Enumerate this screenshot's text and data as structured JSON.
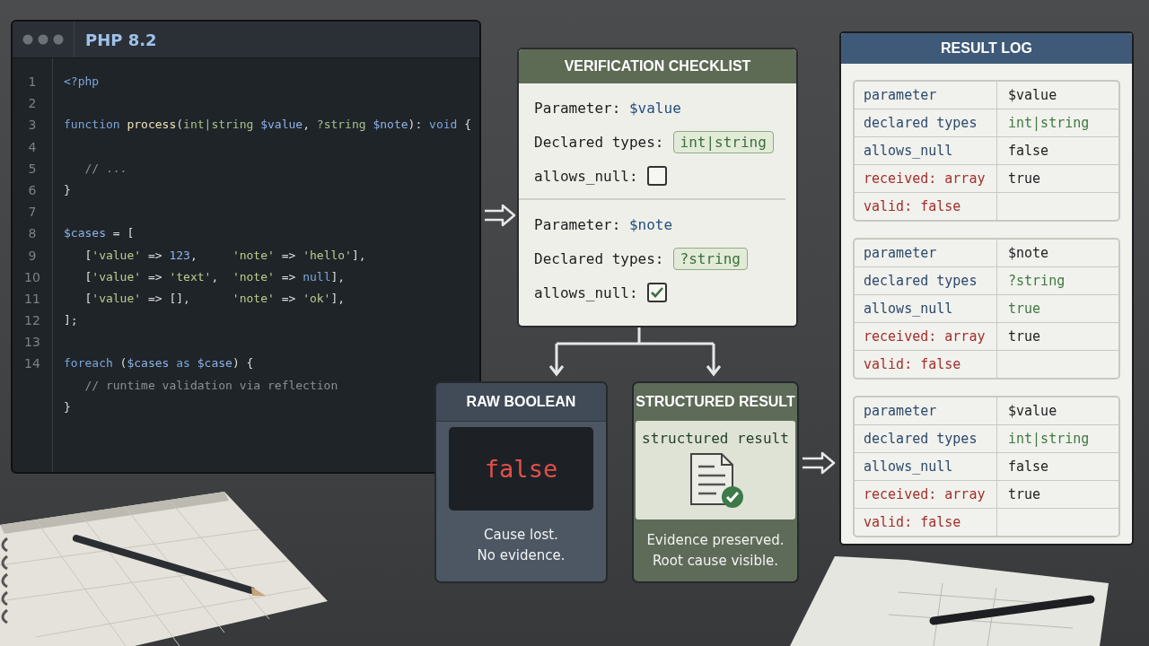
{
  "editor": {
    "title": "PHP 8.2",
    "lines": [
      {
        "number": "1",
        "tokens": [
          {
            "kind": "keyword",
            "text": "<?php"
          }
        ]
      },
      {
        "number": "2"
      },
      {
        "number": "3",
        "tokens": [
          {
            "kind": "keyword",
            "text": "function"
          },
          {
            "kind": "function",
            "text": " process"
          },
          {
            "kind": "plain",
            "text": "("
          },
          {
            "kind": "type",
            "text": "int|string"
          },
          {
            "kind": "variable",
            "text": " $value"
          },
          {
            "kind": "plain",
            "text": ", "
          },
          {
            "kind": "type",
            "text": "?string"
          },
          {
            "kind": "variable",
            "text": " $note"
          },
          {
            "kind": "plain",
            "text": "): "
          },
          {
            "kind": "keyword",
            "text": "void"
          },
          {
            "kind": "plain",
            "text": " {"
          }
        ]
      },
      {
        "number": "4"
      },
      {
        "number": "5",
        "tokens": [
          {
            "kind": "comment",
            "text": "   // ..."
          }
        ]
      },
      {
        "number": "6",
        "tokens": [
          {
            "kind": "plain",
            "text": "}"
          }
        ]
      },
      {
        "number": "7"
      },
      {
        "number": "8",
        "tokens": [
          {
            "kind": "variable",
            "text": "$cases"
          },
          {
            "kind": "plain",
            "text": " = ["
          }
        ]
      },
      {
        "number": "9",
        "tokens": [
          {
            "kind": "plain",
            "text": "   ["
          },
          {
            "kind": "string",
            "text": "'value'"
          },
          {
            "kind": "plain",
            "text": " => "
          },
          {
            "kind": "number",
            "text": "123"
          },
          {
            "kind": "plain",
            "text": ",     "
          },
          {
            "kind": "string",
            "text": "'note'"
          },
          {
            "kind": "plain",
            "text": " => "
          },
          {
            "kind": "string",
            "text": "'hello'"
          },
          {
            "kind": "plain",
            "text": "],"
          }
        ]
      },
      {
        "number": "10",
        "tokens": [
          {
            "kind": "plain",
            "text": "   ["
          },
          {
            "kind": "string",
            "text": "'value'"
          },
          {
            "kind": "plain",
            "text": " => "
          },
          {
            "kind": "string",
            "text": "'text'"
          },
          {
            "kind": "plain",
            "text": ",  "
          },
          {
            "kind": "string",
            "text": "'note'"
          },
          {
            "kind": "plain",
            "text": " => "
          },
          {
            "kind": "keyword",
            "text": "null"
          },
          {
            "kind": "plain",
            "text": "],"
          }
        ]
      },
      {
        "number": "11",
        "tokens": [
          {
            "kind": "plain",
            "text": "   ["
          },
          {
            "kind": "string",
            "text": "'value'"
          },
          {
            "kind": "plain",
            "text": " => [],      "
          },
          {
            "kind": "string",
            "text": "'note'"
          },
          {
            "kind": "plain",
            "text": " => "
          },
          {
            "kind": "string",
            "text": "'ok'"
          },
          {
            "kind": "plain",
            "text": "],"
          }
        ]
      },
      {
        "number": "12",
        "tokens": [
          {
            "kind": "plain",
            "text": "];"
          }
        ]
      },
      {
        "number": "13"
      },
      {
        "number": "14",
        "tokens": [
          {
            "kind": "keyword",
            "text": "foreach"
          },
          {
            "kind": "plain",
            "text": " ("
          },
          {
            "kind": "variable",
            "text": "$cases"
          },
          {
            "kind": "keyword",
            "text": " as "
          },
          {
            "kind": "variable",
            "text": "$case"
          },
          {
            "kind": "plain",
            "text": ") {"
          }
        ]
      },
      {
        "tokens": [
          {
            "kind": "comment",
            "text": "   // runtime validation via reflection"
          }
        ]
      },
      {
        "tokens": [
          {
            "kind": "plain",
            "text": "}"
          }
        ]
      }
    ]
  },
  "checklist": {
    "title": "VERIFICATION CHECKLIST",
    "params": [
      {
        "label": "Parameter:",
        "name": "$value",
        "types_label": "Declared types:",
        "types": "int|string",
        "null_label": "allows_null:",
        "checked": false
      },
      {
        "label": "Parameter:",
        "name": "$note",
        "types_label": "Declared types:",
        "types": "?string",
        "null_label": "allows_null:",
        "checked": true
      }
    ]
  },
  "raw_card": {
    "title": "RAW BOOLEAN",
    "value": "false",
    "caption": [
      "Cause lost.",
      "No evidence."
    ]
  },
  "structured_card": {
    "title": "STRUCTURED RESULT",
    "label": "structured result",
    "caption": [
      "Evidence preserved.",
      "Root cause visible."
    ]
  },
  "result_log": {
    "title": "RESULT LOG",
    "groups": [
      {
        "rows": [
          [
            {
              "kind": "key",
              "text": "parameter"
            },
            {
              "kind": "plain",
              "text": "$value"
            }
          ],
          [
            {
              "kind": "key",
              "text": "declared types"
            },
            {
              "kind": "type",
              "text": "int|string"
            }
          ],
          [
            {
              "kind": "key",
              "text": "allows_null"
            },
            {
              "kind": "plain",
              "text": "false"
            }
          ],
          [
            {
              "kind": "error",
              "text": "received: array"
            },
            {
              "kind": "plain",
              "text": "true"
            }
          ],
          [
            {
              "kind": "error",
              "text": "valid: false"
            }
          ]
        ]
      },
      {
        "rows": [
          [
            {
              "kind": "key",
              "text": "parameter"
            },
            {
              "kind": "plain",
              "text": "$note"
            }
          ],
          [
            {
              "kind": "key",
              "text": "declared types"
            },
            {
              "kind": "type",
              "text": "?string"
            }
          ],
          [
            {
              "kind": "key",
              "text": "allows_null"
            },
            {
              "kind": "type",
              "text": "true"
            }
          ],
          [
            {
              "kind": "error",
              "text": "received: array"
            },
            {
              "kind": "plain",
              "text": "true"
            }
          ],
          [
            {
              "kind": "error",
              "text": "valid: false"
            }
          ]
        ]
      },
      {
        "rows": [
          [
            {
              "kind": "key",
              "text": "parameter"
            },
            {
              "kind": "plain",
              "text": "$value"
            }
          ],
          [
            {
              "kind": "key",
              "text": "declared types"
            },
            {
              "kind": "type",
              "text": "int|string"
            }
          ],
          [
            {
              "kind": "key",
              "text": "allows_null"
            },
            {
              "kind": "plain",
              "text": "false"
            }
          ],
          [
            {
              "kind": "error",
              "text": "received: array"
            },
            {
              "kind": "plain",
              "text": "true"
            }
          ],
          [
            {
              "kind": "error",
              "text": "valid: false"
            }
          ]
        ]
      }
    ]
  }
}
